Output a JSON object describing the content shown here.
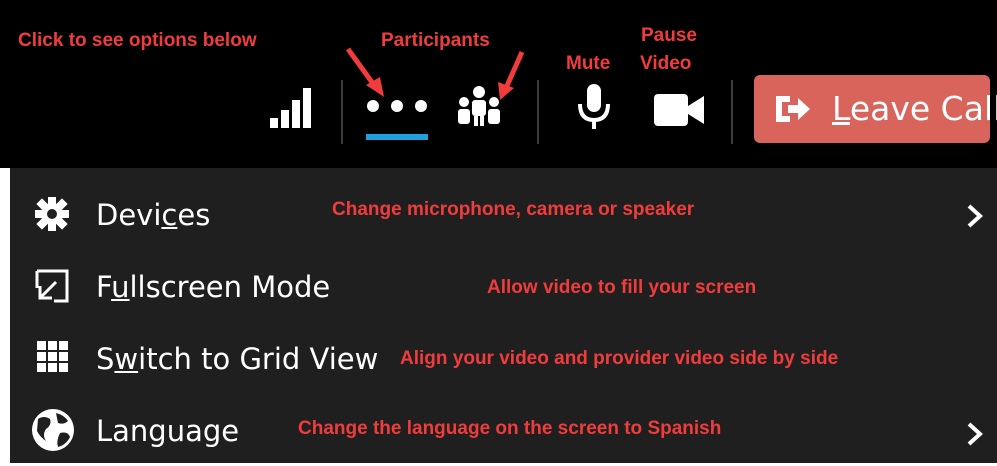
{
  "annotations": {
    "options": "Click to see  options below",
    "participants": "Participants",
    "mute": "Mute",
    "pause_line1": "Pause",
    "pause_line2": "Video",
    "devices": "Change microphone, camera or speaker",
    "fullscreen": "Allow video to fill your screen",
    "grid": "Align your video and provider video side by side",
    "language": "Change the language on the screen to Spanish"
  },
  "toolbar": {
    "leave_call": {
      "mnemonic": "L",
      "rest": "eave Call"
    },
    "icons": [
      "signal-strength-icon",
      "more-options-icon",
      "participants-icon",
      "microphone-icon",
      "video-camera-icon",
      "leave-call-icon"
    ]
  },
  "menu": {
    "devices": {
      "pre": "Devi",
      "mnemonic": "c",
      "post": "es",
      "icon": "gear-icon",
      "has_submenu": true
    },
    "fullscreen": {
      "pre": "F",
      "mnemonic": "u",
      "post": "llscreen Mode",
      "icon": "fullscreen-icon",
      "has_submenu": false
    },
    "grid": {
      "pre": "S",
      "mnemonic": "w",
      "post": "itch to Grid View",
      "icon": "grid-icon",
      "has_submenu": false
    },
    "language": {
      "pre": "",
      "mnemonic": "",
      "post": "Language",
      "icon": "globe-icon",
      "has_submenu": true
    }
  },
  "colors": {
    "annotation": "#f03c3c",
    "topbar": "#000000",
    "menu": "#1f1f1f",
    "leave_button": "#d9645c",
    "active_tab": "#1ea0dc"
  }
}
